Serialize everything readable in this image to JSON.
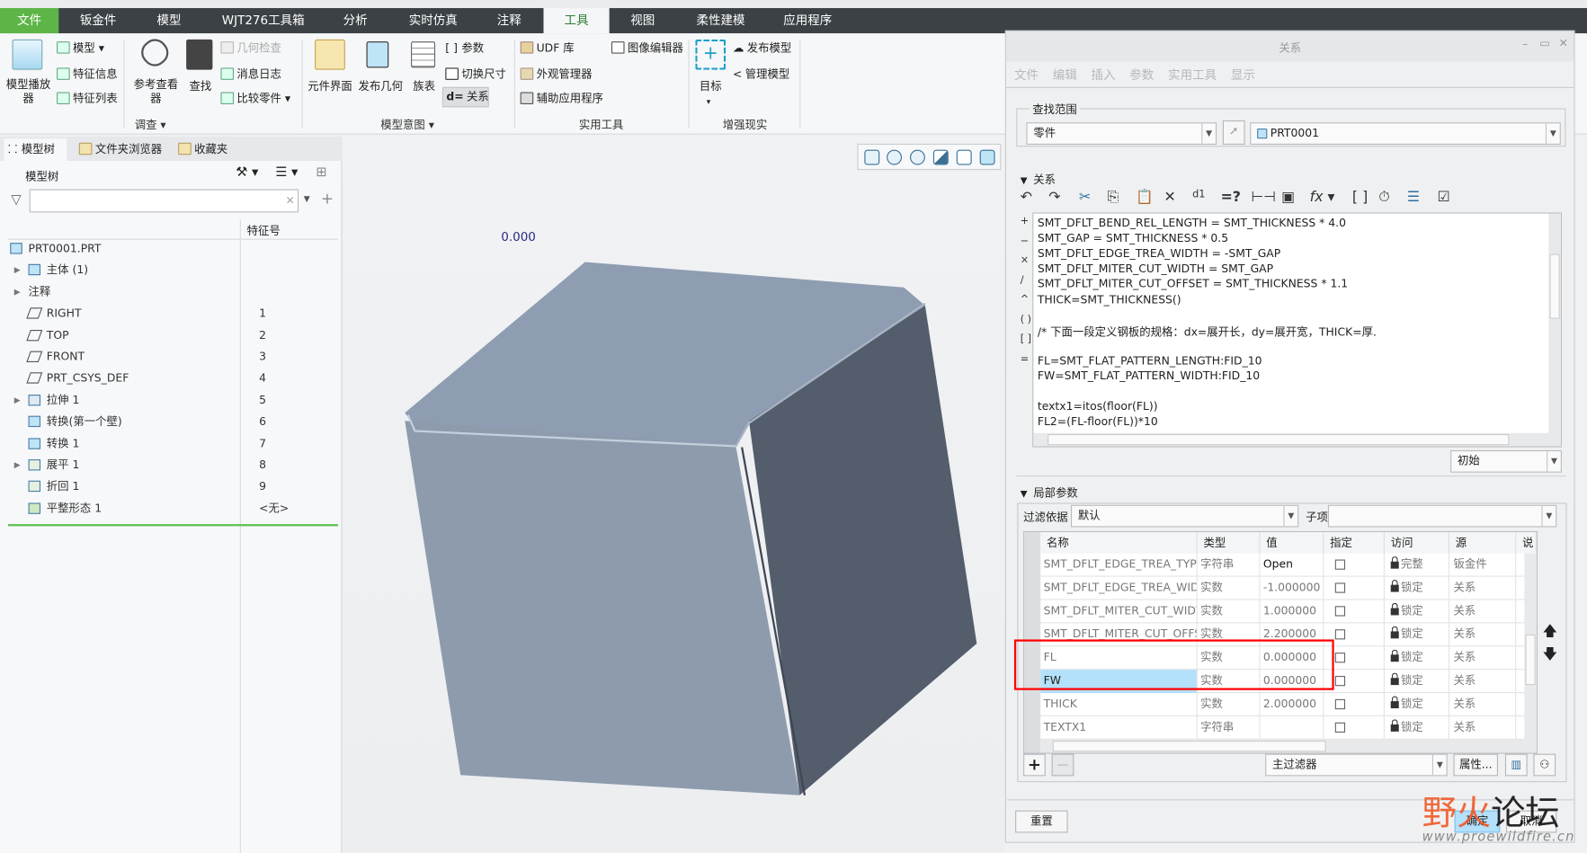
{
  "ribbon": {
    "tabs": [
      "文件",
      "钣金件",
      "模型",
      "WJT276工具箱",
      "分析",
      "实时仿真",
      "注释",
      "工具",
      "视图",
      "柔性建模",
      "应用程序"
    ],
    "active_tab": "工具",
    "investigate": {
      "model_player": "模型播放器",
      "model": "模型",
      "feature_info": "特征信息",
      "feature_list": "特征列表",
      "ref_viewer": "参考查看器",
      "find": "查找",
      "geom_check": "几何检查",
      "msg_log": "消息日志",
      "compare": "比较零件",
      "group": "调查"
    },
    "model_intent": {
      "comp_interface": "元件界面",
      "publish_geom": "发布几何",
      "family_table": "族表",
      "params": "参数",
      "switch_dims": "切换尺寸",
      "relations": "关系",
      "group": "模型意图"
    },
    "utilities": {
      "udf": "UDF 库",
      "appearance": "外观管理器",
      "aux_apps": "辅助应用程序",
      "image_editor": "图像编辑器",
      "group": "实用工具"
    },
    "ar": {
      "target": "目标",
      "publish_model": "发布模型",
      "manage_model": "管理模型",
      "group": "增强现实"
    }
  },
  "left_panel": {
    "tabs": [
      "模型树",
      "文件夹浏览器",
      "收藏夹"
    ],
    "header": "模型树",
    "search_placeholder": "",
    "column": "特征号",
    "items": [
      {
        "label": "PRT0001.PRT",
        "num": "",
        "expand": false,
        "level": 0
      },
      {
        "label": "主体 (1)",
        "num": "",
        "expand": true,
        "level": 1
      },
      {
        "label": "注释",
        "num": "",
        "expand": true,
        "level": 1
      },
      {
        "label": "RIGHT",
        "num": "1",
        "expand": false,
        "level": 1
      },
      {
        "label": "TOP",
        "num": "2",
        "expand": false,
        "level": 1
      },
      {
        "label": "FRONT",
        "num": "3",
        "expand": false,
        "level": 1
      },
      {
        "label": "PRT_CSYS_DEF",
        "num": "4",
        "expand": false,
        "level": 1
      },
      {
        "label": "拉伸 1",
        "num": "5",
        "expand": true,
        "level": 1
      },
      {
        "label": "转换(第一个壁)",
        "num": "6",
        "expand": false,
        "level": 1
      },
      {
        "label": "转换 1",
        "num": "7",
        "expand": false,
        "level": 1
      },
      {
        "label": "展平 1",
        "num": "8",
        "expand": true,
        "level": 1
      },
      {
        "label": "折回 1",
        "num": "9",
        "expand": false,
        "level": 1
      },
      {
        "label": "平整形态 1",
        "num": "<无>",
        "expand": false,
        "level": 1
      }
    ]
  },
  "graphics": {
    "readout": "0.000",
    "colors": {
      "top": "#8e9db2",
      "front": "#8d9bad",
      "side": "#545d6c"
    }
  },
  "dialog": {
    "title": "关系",
    "menu": [
      "文件",
      "编辑",
      "插入",
      "参数",
      "实用工具",
      "显示"
    ],
    "scope_label": "查找范围",
    "scope_type": "零件",
    "scope_model": "PRT0001",
    "relations_label": "关系",
    "operators": [
      "+",
      "−",
      "×",
      "/",
      "^",
      "( )",
      "[ ]",
      "="
    ],
    "relations": [
      "SMT_DFLT_BEND_REL_LENGTH = SMT_THICKNESS * 4.0",
      "SMT_GAP = SMT_THICKNESS * 0.5",
      "SMT_DFLT_EDGE_TREA_WIDTH = -SMT_GAP",
      "SMT_DFLT_MITER_CUT_WIDTH = SMT_GAP",
      "SMT_DFLT_MITER_CUT_OFFSET = SMT_THICKNESS * 1.1",
      "THICK=SMT_THICKNESS()",
      "",
      "/* 下面一段定义钢板的规格：dx=展开长，dy=展开宽，THICK=厚.",
      "",
      "FL=SMT_FLAT_PATTERN_LENGTH:FID_10",
      "FW=SMT_FLAT_PATTERN_WIDTH:FID_10",
      "",
      "textx1=itos(floor(FL))",
      "FL2=(FL-floor(FL))*10"
    ],
    "sort_option": "初始",
    "local_params_label": "局部参数",
    "filter_label": "过滤依据",
    "filter_value": "默认",
    "sub_label": "子项",
    "sub_value": "",
    "columns": [
      "名称",
      "类型",
      "值",
      "指定",
      "访问",
      "源",
      "说"
    ],
    "rows": [
      {
        "name": "SMT_DFLT_EDGE_TREA_TYPE",
        "type": "字符串",
        "value": "Open",
        "designated": false,
        "access": "完整",
        "source": "钣金件"
      },
      {
        "name": "SMT_DFLT_EDGE_TREA_WIDT",
        "type": "实数",
        "value": "-1.000000",
        "designated": false,
        "access": "锁定",
        "source": "关系"
      },
      {
        "name": "SMT_DFLT_MITER_CUT_WIDT",
        "type": "实数",
        "value": "1.000000",
        "designated": false,
        "access": "锁定",
        "source": "关系"
      },
      {
        "name": "SMT_DFLT_MITER_CUT_OFFSE",
        "type": "实数",
        "value": "2.200000",
        "designated": false,
        "access": "锁定",
        "source": "关系"
      },
      {
        "name": "FL",
        "type": "实数",
        "value": "0.000000",
        "designated": false,
        "access": "锁定",
        "source": "关系"
      },
      {
        "name": "FW",
        "type": "实数",
        "value": "0.000000",
        "designated": false,
        "access": "锁定",
        "source": "关系",
        "selected": true
      },
      {
        "name": "THICK",
        "type": "实数",
        "value": "2.000000",
        "designated": false,
        "access": "锁定",
        "source": "关系"
      },
      {
        "name": "TEXTX1",
        "type": "字符串",
        "value": "",
        "designated": false,
        "access": "锁定",
        "source": "关系"
      }
    ],
    "main_filter": "主过滤器",
    "properties_button": "属性...",
    "reset_button": "重置",
    "ok_button": "确定",
    "cancel_button": "取消",
    "highlight_color": "#ff0000",
    "selected_color": "#b3e0fb"
  },
  "watermark": {
    "title": "野火论坛",
    "url": "www.proewildfire.cn"
  }
}
